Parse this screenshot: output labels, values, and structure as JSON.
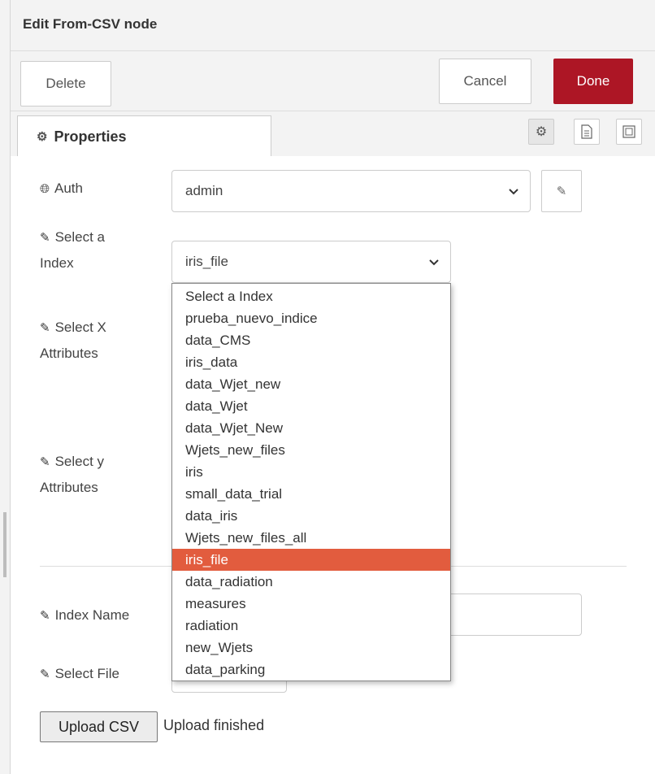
{
  "header": {
    "title": "Edit From-CSV node"
  },
  "toolbar": {
    "delete_label": "Delete",
    "cancel_label": "Cancel",
    "done_label": "Done"
  },
  "tabs": {
    "properties_label": "Properties"
  },
  "fields": {
    "auth": {
      "label": "Auth",
      "value": "admin"
    },
    "index": {
      "label_line1": "Select a",
      "label_line2": "Index",
      "value": "iris_file"
    },
    "x_attributes": {
      "label_line1": "Select X",
      "label_line2": "Attributes"
    },
    "y_attributes": {
      "label_line1": "Select y",
      "label_line2": "Attributes"
    },
    "index_name": {
      "label": "Index Name"
    },
    "select_file": {
      "label": "Select File"
    }
  },
  "dropdown": {
    "selected": "iris_file",
    "options": [
      "Select a Index",
      "prueba_nuevo_indice",
      "data_CMS",
      "iris_data",
      "data_Wjet_new",
      "data_Wjet",
      "data_Wjet_New",
      "Wjets_new_files",
      "iris",
      "small_data_trial",
      "data_iris",
      "Wjets_new_files_all",
      "iris_file",
      "data_radiation",
      "measures",
      "radiation",
      "new_Wjets",
      "data_parking"
    ]
  },
  "upload": {
    "button_label": "Upload CSV",
    "status": "Upload finished"
  },
  "colors": {
    "done": "#ad1625",
    "highlight": "#e25c3e"
  },
  "icons": [
    "gear-icon",
    "globe-icon",
    "pencil-icon",
    "chevron-down-icon",
    "document-icon",
    "frame-icon"
  ]
}
